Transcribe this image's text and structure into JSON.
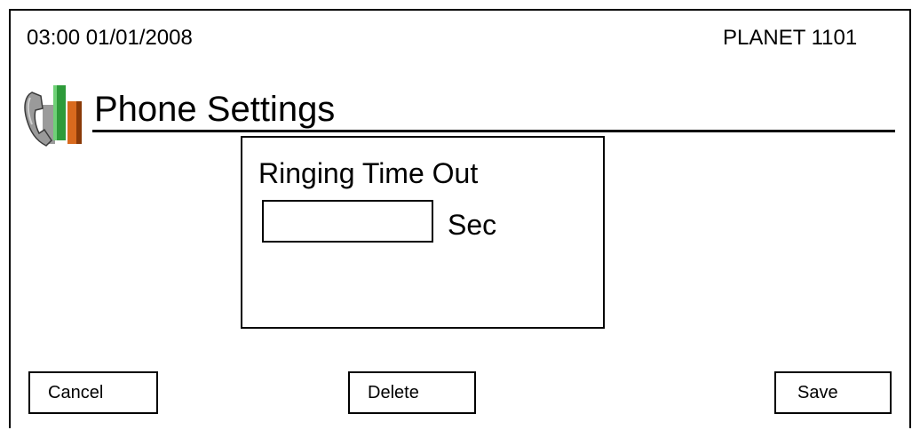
{
  "status": {
    "datetime": "03:00 01/01/2008",
    "device": "PLANET 1101"
  },
  "header": {
    "title": "Phone Settings",
    "icon": "phone-settings-icon"
  },
  "panel": {
    "label": "Ringing Time Out",
    "input_value": "",
    "unit": "Sec"
  },
  "buttons": {
    "cancel": "Cancel",
    "delete": "Delete",
    "save": "Save"
  },
  "colors": {
    "icon_green": "#2e9b3a",
    "icon_orange": "#d96a1e",
    "handset_gray": "#8a8a8a"
  }
}
